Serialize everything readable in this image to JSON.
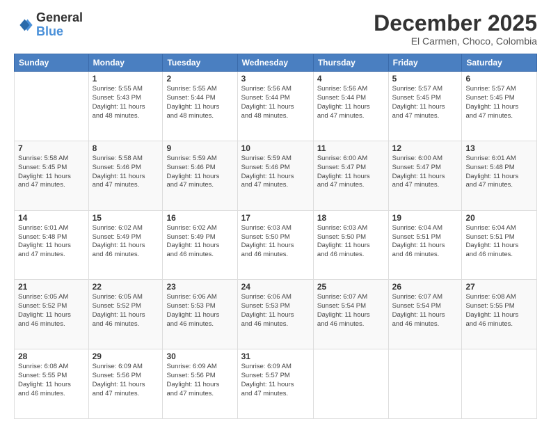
{
  "logo": {
    "line1": "General",
    "line2": "Blue"
  },
  "header": {
    "title": "December 2025",
    "subtitle": "El Carmen, Choco, Colombia"
  },
  "weekdays": [
    "Sunday",
    "Monday",
    "Tuesday",
    "Wednesday",
    "Thursday",
    "Friday",
    "Saturday"
  ],
  "weeks": [
    [
      {
        "day": "",
        "info": ""
      },
      {
        "day": "1",
        "info": "Sunrise: 5:55 AM\nSunset: 5:43 PM\nDaylight: 11 hours\nand 48 minutes."
      },
      {
        "day": "2",
        "info": "Sunrise: 5:55 AM\nSunset: 5:44 PM\nDaylight: 11 hours\nand 48 minutes."
      },
      {
        "day": "3",
        "info": "Sunrise: 5:56 AM\nSunset: 5:44 PM\nDaylight: 11 hours\nand 48 minutes."
      },
      {
        "day": "4",
        "info": "Sunrise: 5:56 AM\nSunset: 5:44 PM\nDaylight: 11 hours\nand 47 minutes."
      },
      {
        "day": "5",
        "info": "Sunrise: 5:57 AM\nSunset: 5:45 PM\nDaylight: 11 hours\nand 47 minutes."
      },
      {
        "day": "6",
        "info": "Sunrise: 5:57 AM\nSunset: 5:45 PM\nDaylight: 11 hours\nand 47 minutes."
      }
    ],
    [
      {
        "day": "7",
        "info": "Sunrise: 5:58 AM\nSunset: 5:45 PM\nDaylight: 11 hours\nand 47 minutes."
      },
      {
        "day": "8",
        "info": "Sunrise: 5:58 AM\nSunset: 5:46 PM\nDaylight: 11 hours\nand 47 minutes."
      },
      {
        "day": "9",
        "info": "Sunrise: 5:59 AM\nSunset: 5:46 PM\nDaylight: 11 hours\nand 47 minutes."
      },
      {
        "day": "10",
        "info": "Sunrise: 5:59 AM\nSunset: 5:46 PM\nDaylight: 11 hours\nand 47 minutes."
      },
      {
        "day": "11",
        "info": "Sunrise: 6:00 AM\nSunset: 5:47 PM\nDaylight: 11 hours\nand 47 minutes."
      },
      {
        "day": "12",
        "info": "Sunrise: 6:00 AM\nSunset: 5:47 PM\nDaylight: 11 hours\nand 47 minutes."
      },
      {
        "day": "13",
        "info": "Sunrise: 6:01 AM\nSunset: 5:48 PM\nDaylight: 11 hours\nand 47 minutes."
      }
    ],
    [
      {
        "day": "14",
        "info": "Sunrise: 6:01 AM\nSunset: 5:48 PM\nDaylight: 11 hours\nand 47 minutes."
      },
      {
        "day": "15",
        "info": "Sunrise: 6:02 AM\nSunset: 5:49 PM\nDaylight: 11 hours\nand 46 minutes."
      },
      {
        "day": "16",
        "info": "Sunrise: 6:02 AM\nSunset: 5:49 PM\nDaylight: 11 hours\nand 46 minutes."
      },
      {
        "day": "17",
        "info": "Sunrise: 6:03 AM\nSunset: 5:50 PM\nDaylight: 11 hours\nand 46 minutes."
      },
      {
        "day": "18",
        "info": "Sunrise: 6:03 AM\nSunset: 5:50 PM\nDaylight: 11 hours\nand 46 minutes."
      },
      {
        "day": "19",
        "info": "Sunrise: 6:04 AM\nSunset: 5:51 PM\nDaylight: 11 hours\nand 46 minutes."
      },
      {
        "day": "20",
        "info": "Sunrise: 6:04 AM\nSunset: 5:51 PM\nDaylight: 11 hours\nand 46 minutes."
      }
    ],
    [
      {
        "day": "21",
        "info": "Sunrise: 6:05 AM\nSunset: 5:52 PM\nDaylight: 11 hours\nand 46 minutes."
      },
      {
        "day": "22",
        "info": "Sunrise: 6:05 AM\nSunset: 5:52 PM\nDaylight: 11 hours\nand 46 minutes."
      },
      {
        "day": "23",
        "info": "Sunrise: 6:06 AM\nSunset: 5:53 PM\nDaylight: 11 hours\nand 46 minutes."
      },
      {
        "day": "24",
        "info": "Sunrise: 6:06 AM\nSunset: 5:53 PM\nDaylight: 11 hours\nand 46 minutes."
      },
      {
        "day": "25",
        "info": "Sunrise: 6:07 AM\nSunset: 5:54 PM\nDaylight: 11 hours\nand 46 minutes."
      },
      {
        "day": "26",
        "info": "Sunrise: 6:07 AM\nSunset: 5:54 PM\nDaylight: 11 hours\nand 46 minutes."
      },
      {
        "day": "27",
        "info": "Sunrise: 6:08 AM\nSunset: 5:55 PM\nDaylight: 11 hours\nand 46 minutes."
      }
    ],
    [
      {
        "day": "28",
        "info": "Sunrise: 6:08 AM\nSunset: 5:55 PM\nDaylight: 11 hours\nand 46 minutes."
      },
      {
        "day": "29",
        "info": "Sunrise: 6:09 AM\nSunset: 5:56 PM\nDaylight: 11 hours\nand 47 minutes."
      },
      {
        "day": "30",
        "info": "Sunrise: 6:09 AM\nSunset: 5:56 PM\nDaylight: 11 hours\nand 47 minutes."
      },
      {
        "day": "31",
        "info": "Sunrise: 6:09 AM\nSunset: 5:57 PM\nDaylight: 11 hours\nand 47 minutes."
      },
      {
        "day": "",
        "info": ""
      },
      {
        "day": "",
        "info": ""
      },
      {
        "day": "",
        "info": ""
      }
    ]
  ]
}
